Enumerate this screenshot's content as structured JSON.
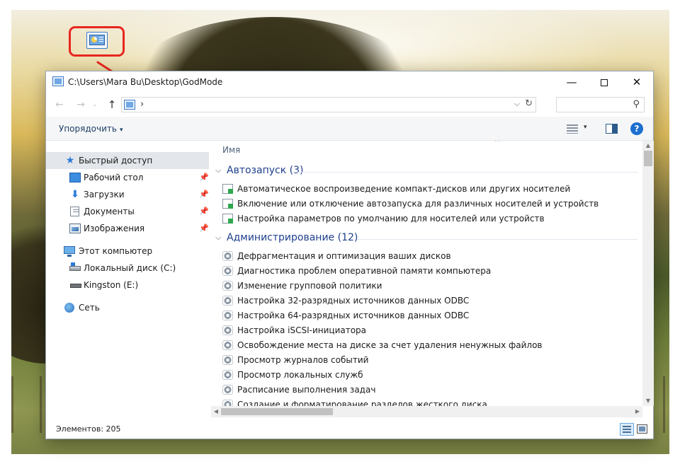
{
  "window": {
    "title": "C:\\Users\\Mara Bu\\Desktop\\GodMode",
    "minimize_glyph": "—",
    "close_glyph": "✕"
  },
  "toolbar": {
    "organize_label": "Упорядочить",
    "caret": "▾"
  },
  "address": {
    "separator": "›",
    "dropdown": "⌵",
    "refresh": "↻"
  },
  "search": {
    "placeholder": "",
    "icon": "⚲"
  },
  "nav_glyphs": {
    "back": "←",
    "forward": "→",
    "recent": "⌄",
    "up": "↑"
  },
  "sidebar": {
    "items": [
      {
        "label": "Быстрый доступ",
        "icon": "star-icon",
        "pinned": false
      },
      {
        "label": "Рабочий стол",
        "icon": "desktop-icon",
        "pinned": true
      },
      {
        "label": "Загрузки",
        "icon": "downloads-icon",
        "pinned": true
      },
      {
        "label": "Документы",
        "icon": "documents-icon",
        "pinned": true
      },
      {
        "label": "Изображения",
        "icon": "pictures-icon",
        "pinned": true
      },
      {
        "label": "Этот компьютер",
        "icon": "computer-icon",
        "pinned": false
      },
      {
        "label": "Локальный диск (C:)",
        "icon": "drive-icon",
        "pinned": false
      },
      {
        "label": "Kingston (E:)",
        "icon": "usb-drive-icon",
        "pinned": false
      },
      {
        "label": "Сеть",
        "icon": "network-icon",
        "pinned": false
      }
    ],
    "pin_glyph": "📌"
  },
  "content": {
    "column_header": "Имя",
    "sort_glyph": "^",
    "groups": [
      {
        "name": "Автозапуск (3)",
        "icon": "autoplay-icon",
        "items": [
          "Автоматическое воспроизведение компакт-дисков или других носителей",
          "Включение или отключение автозапуска для различных носителей и устройств",
          "Настройка параметров по умолчанию для носителей или устройств"
        ]
      },
      {
        "name": "Администрирование (12)",
        "icon": "admin-tools-icon",
        "items": [
          "Дефрагментация и оптимизация ваших дисков",
          "Диагностика проблем оперативной памяти компьютера",
          "Изменение групповой политики",
          "Настройка 32-разрядных источников данных ODBC",
          "Настройка 64-разрядных источников данных ODBC",
          "Настройка iSCSI-инициатора",
          "Освобождение места на диске за счет удаления ненужных файлов",
          "Просмотр журналов событий",
          "Просмотр локальных служб",
          "Расписание выполнения задач",
          "Создание и форматирование разделов жесткого диска"
        ]
      }
    ]
  },
  "statusbar": {
    "item_count": "Элементов: 205"
  },
  "colors": {
    "annotation_red": "#e8261f",
    "group_header": "#1e3f8c",
    "selected_nav": "#e3e6ea"
  }
}
